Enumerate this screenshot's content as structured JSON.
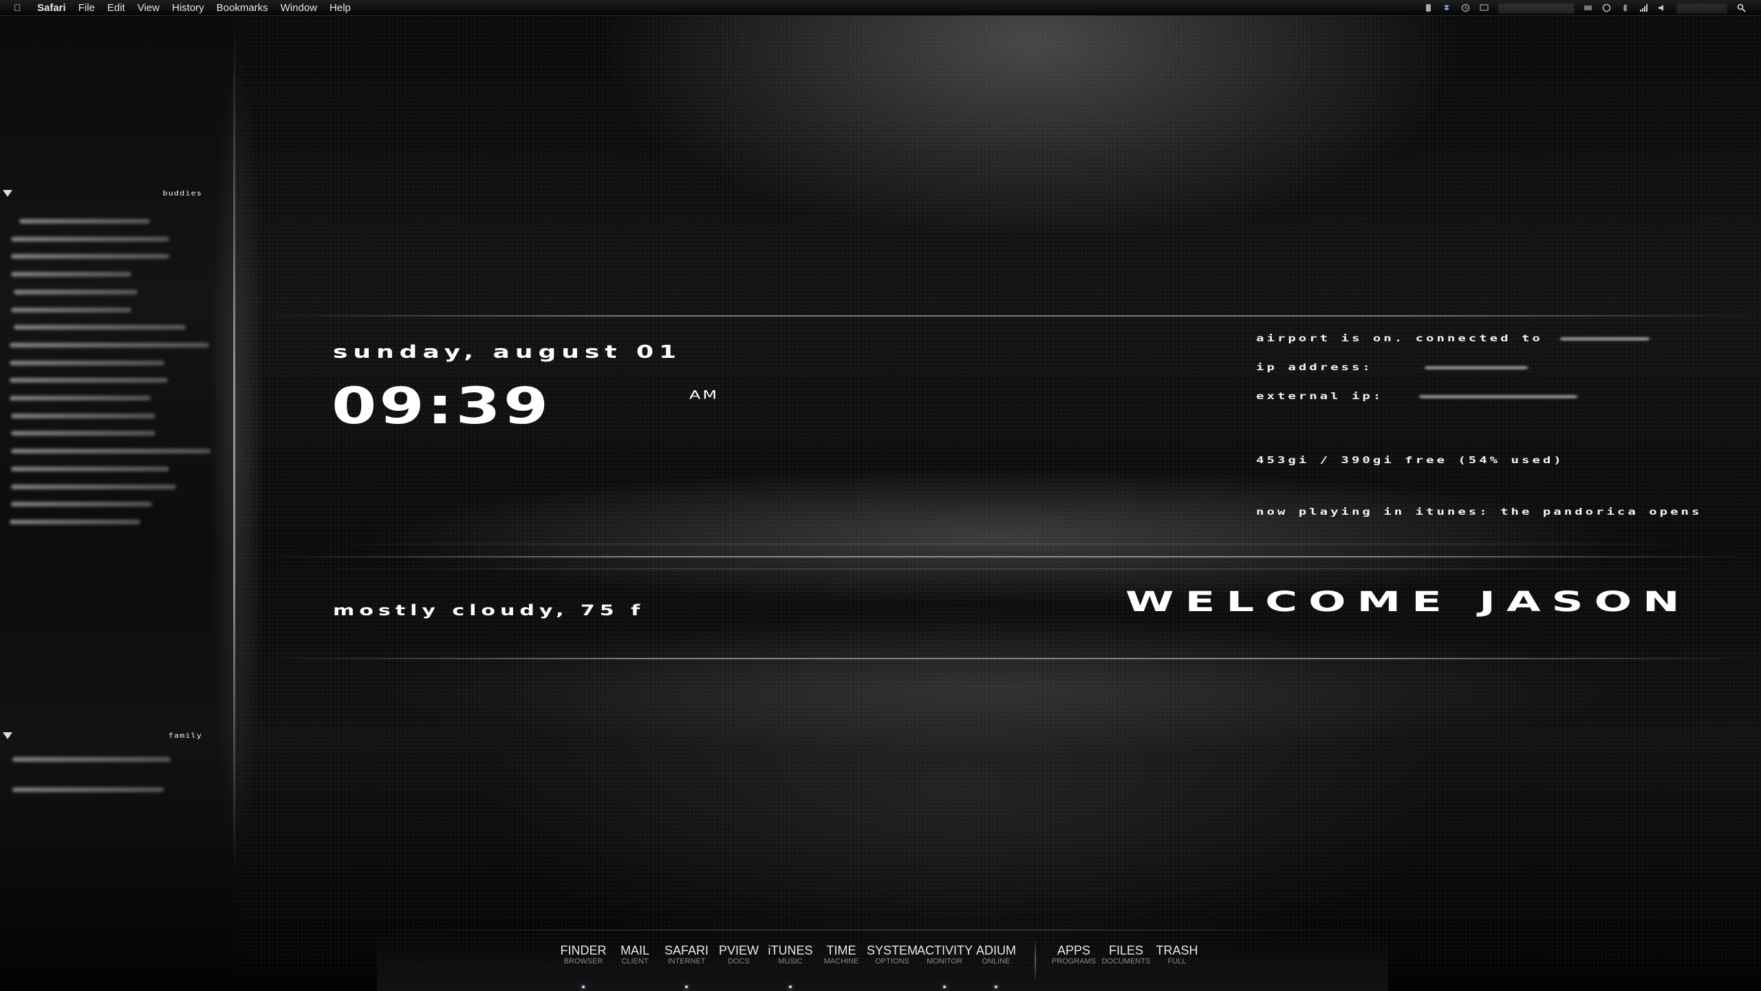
{
  "menubar": {
    "apple_icon": "apple-icon",
    "menus": [
      "Safari",
      "File",
      "Edit",
      "View",
      "History",
      "Bookmarks",
      "Window",
      "Help"
    ],
    "status_icons": [
      "adium-icon",
      "bluetooth-icon",
      "timemachine-icon",
      "display-icon",
      "wifi-icon",
      "volume-icon",
      "search-icon"
    ]
  },
  "buddies": {
    "groups": [
      {
        "name": "buddies",
        "count": 18
      },
      {
        "name": "family",
        "count": 2
      }
    ]
  },
  "hud": {
    "date": "sunday, august 01",
    "time": "09:39",
    "ampm": "AM",
    "weather": "mostly cloudy, 75 F",
    "welcome": "WELCOME Jason",
    "airport_label": "airport is on.  connected to",
    "ip_label": "ip address:",
    "external_ip_label": "external ip:",
    "disk": "453gi / 390gi free (54% used)",
    "now_playing": "now playing in itunes: the pandorica opens"
  },
  "dock": {
    "items": [
      {
        "label": "FINDER",
        "sub": "BROWSER",
        "running": true
      },
      {
        "label": "MAIL",
        "sub": "CLIENT",
        "running": false
      },
      {
        "label": "SAFARI",
        "sub": "INTERNET",
        "running": true
      },
      {
        "label": "PVIEW",
        "sub": "DOCS",
        "running": false
      },
      {
        "label": "iTUNES",
        "sub": "MUSIC",
        "running": true
      },
      {
        "label": "TIME",
        "sub": "MACHINE",
        "running": false
      },
      {
        "label": "SYSTEM",
        "sub": "OPTIONS",
        "running": false
      },
      {
        "label": "ACTIVITY",
        "sub": "MONITOR",
        "running": true
      },
      {
        "label": "ADIUM",
        "sub": "ONLINE",
        "running": true
      },
      {
        "label": "APPS",
        "sub": "PROGRAMS",
        "running": false
      },
      {
        "label": "FILES",
        "sub": "DOCUMENTS",
        "running": false
      },
      {
        "label": "TRASH",
        "sub": "FULL",
        "running": false
      }
    ]
  }
}
